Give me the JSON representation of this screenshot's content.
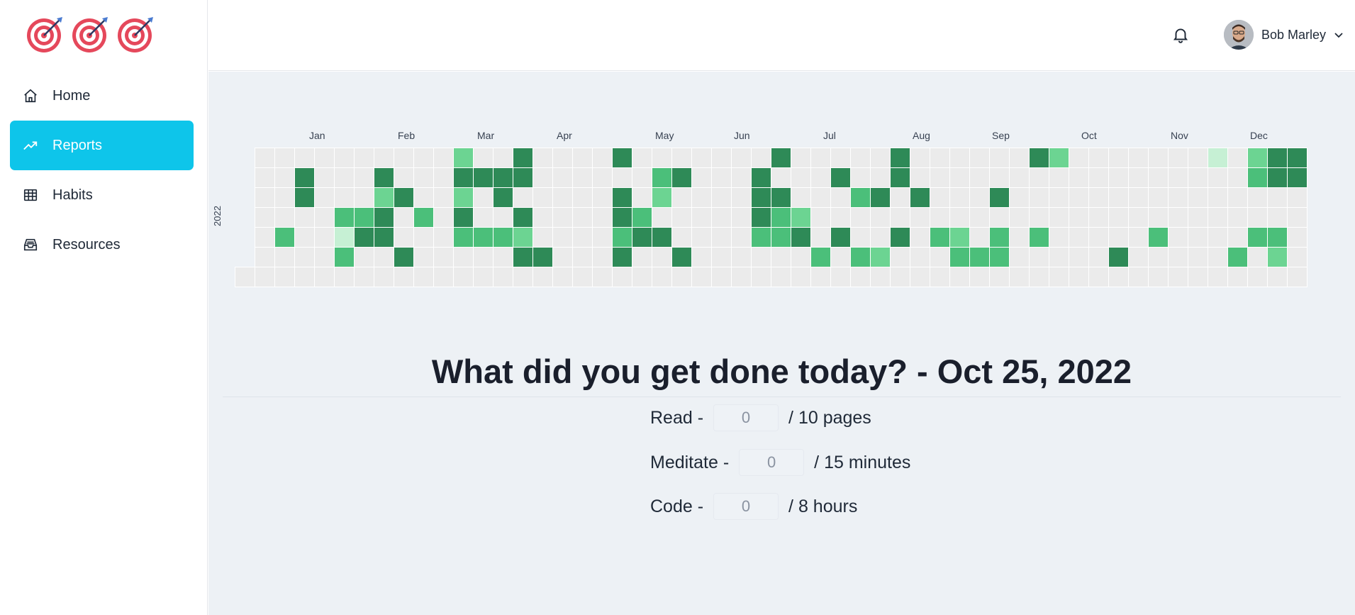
{
  "nav": {
    "items": [
      {
        "label": "Home",
        "icon": "home-icon"
      },
      {
        "label": "Reports",
        "icon": "trending-up-icon",
        "active": true
      },
      {
        "label": "Habits",
        "icon": "table-icon"
      },
      {
        "label": "Resources",
        "icon": "inbox-icon"
      }
    ]
  },
  "header": {
    "user_name": "Bob Marley"
  },
  "heatmap": {
    "year": "2022",
    "months": [
      "Jan",
      "Feb",
      "Mar",
      "Apr",
      "May",
      "Jun",
      "Jul",
      "Aug",
      "Sep",
      "Oct",
      "Nov",
      "Dec"
    ],
    "colors": {
      "empty": "#ebebeb",
      "l1": "#c6f0d4",
      "l2": "#6cd492",
      "l3": "#4bbf7a",
      "l4": "#2e8a57"
    },
    "rows": [
      "0000000000200400004000000040000040000004200000001024400000000000000000000",
      "0040004000444400000034000400040040000000000000000034400000000000000000000",
      "0040002400204000004020000440003404000400000000000000000000000000000000000",
      "0000334030400400004300000432000000000000000000000000000000000000000000000",
      "0300144000333200003440000334040040320303000003000033000000000000000000000",
      "0000300400000440004004000000303200033300000400000302000000000000000000000",
      "0000000000000000000000000000000000000000000000000000000000000000000000000"
    ]
  },
  "main": {
    "title": "What did you get done today? - Oct 25, 2022"
  },
  "habits": [
    {
      "label": "Read -",
      "placeholder": "0",
      "target": "/ 10 pages"
    },
    {
      "label": "Meditate -",
      "placeholder": "0",
      "target": "/ 15 minutes"
    },
    {
      "label": "Code -",
      "placeholder": "0",
      "target": "/ 8 hours"
    }
  ]
}
